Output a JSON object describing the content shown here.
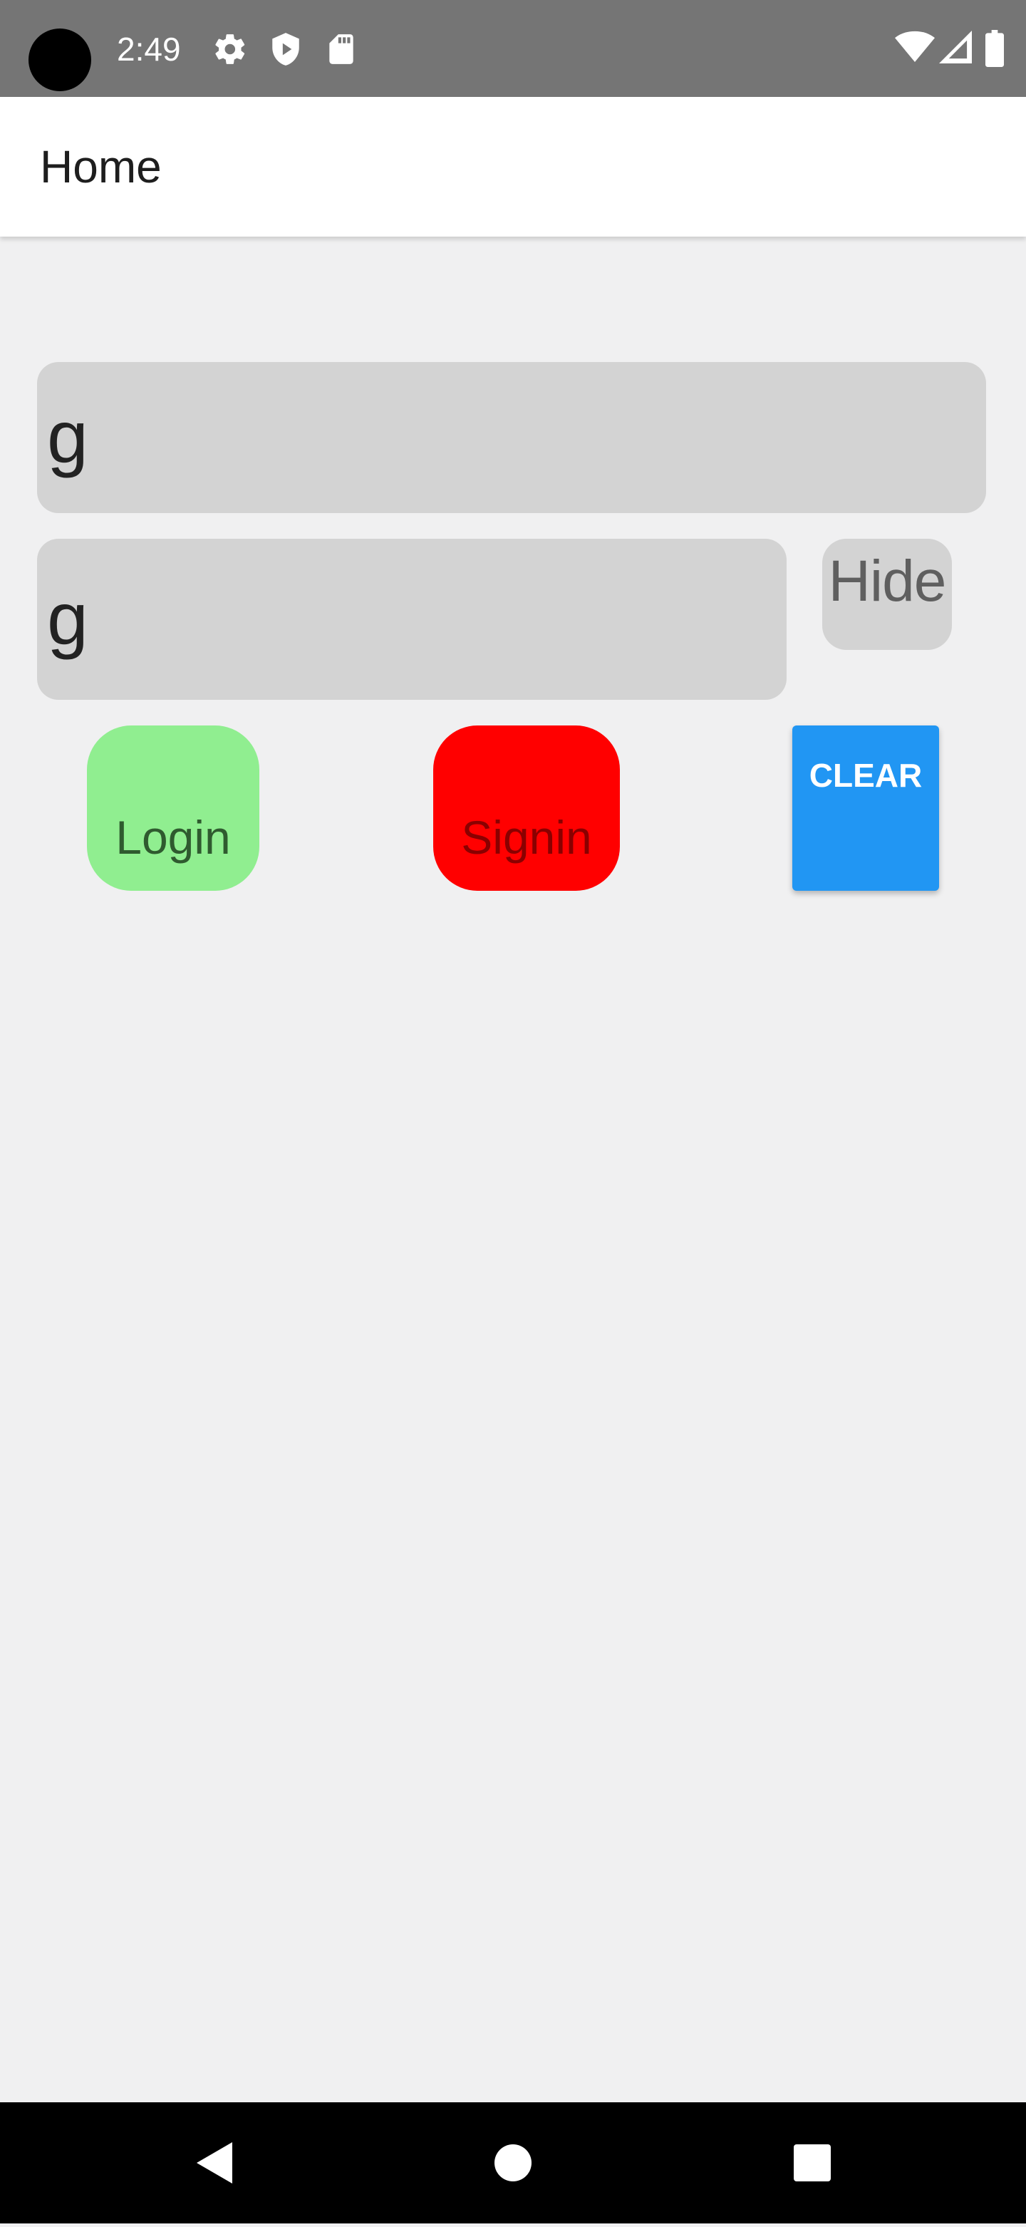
{
  "status_bar": {
    "time": "2:49",
    "left_icons": [
      "gear-icon",
      "shield-icon",
      "sd-card-icon"
    ],
    "right_icons": [
      "wifi-icon",
      "cell-signal-icon",
      "battery-icon"
    ]
  },
  "app_bar": {
    "title": "Home"
  },
  "form": {
    "username_value": "g",
    "password_value": "g",
    "hide_label": "Hide"
  },
  "actions": {
    "login_label": "Login",
    "signin_label": "Signin",
    "clear_label": "CLEAR"
  },
  "colors": {
    "status_bar": "#757575",
    "background": "#f0f0f1",
    "field": "#d3d3d3",
    "login": "#90ee90",
    "signin": "#ff0000",
    "clear": "#2196f3"
  },
  "nav_bar": {
    "icons": [
      "back-icon",
      "home-icon",
      "recents-icon"
    ]
  }
}
